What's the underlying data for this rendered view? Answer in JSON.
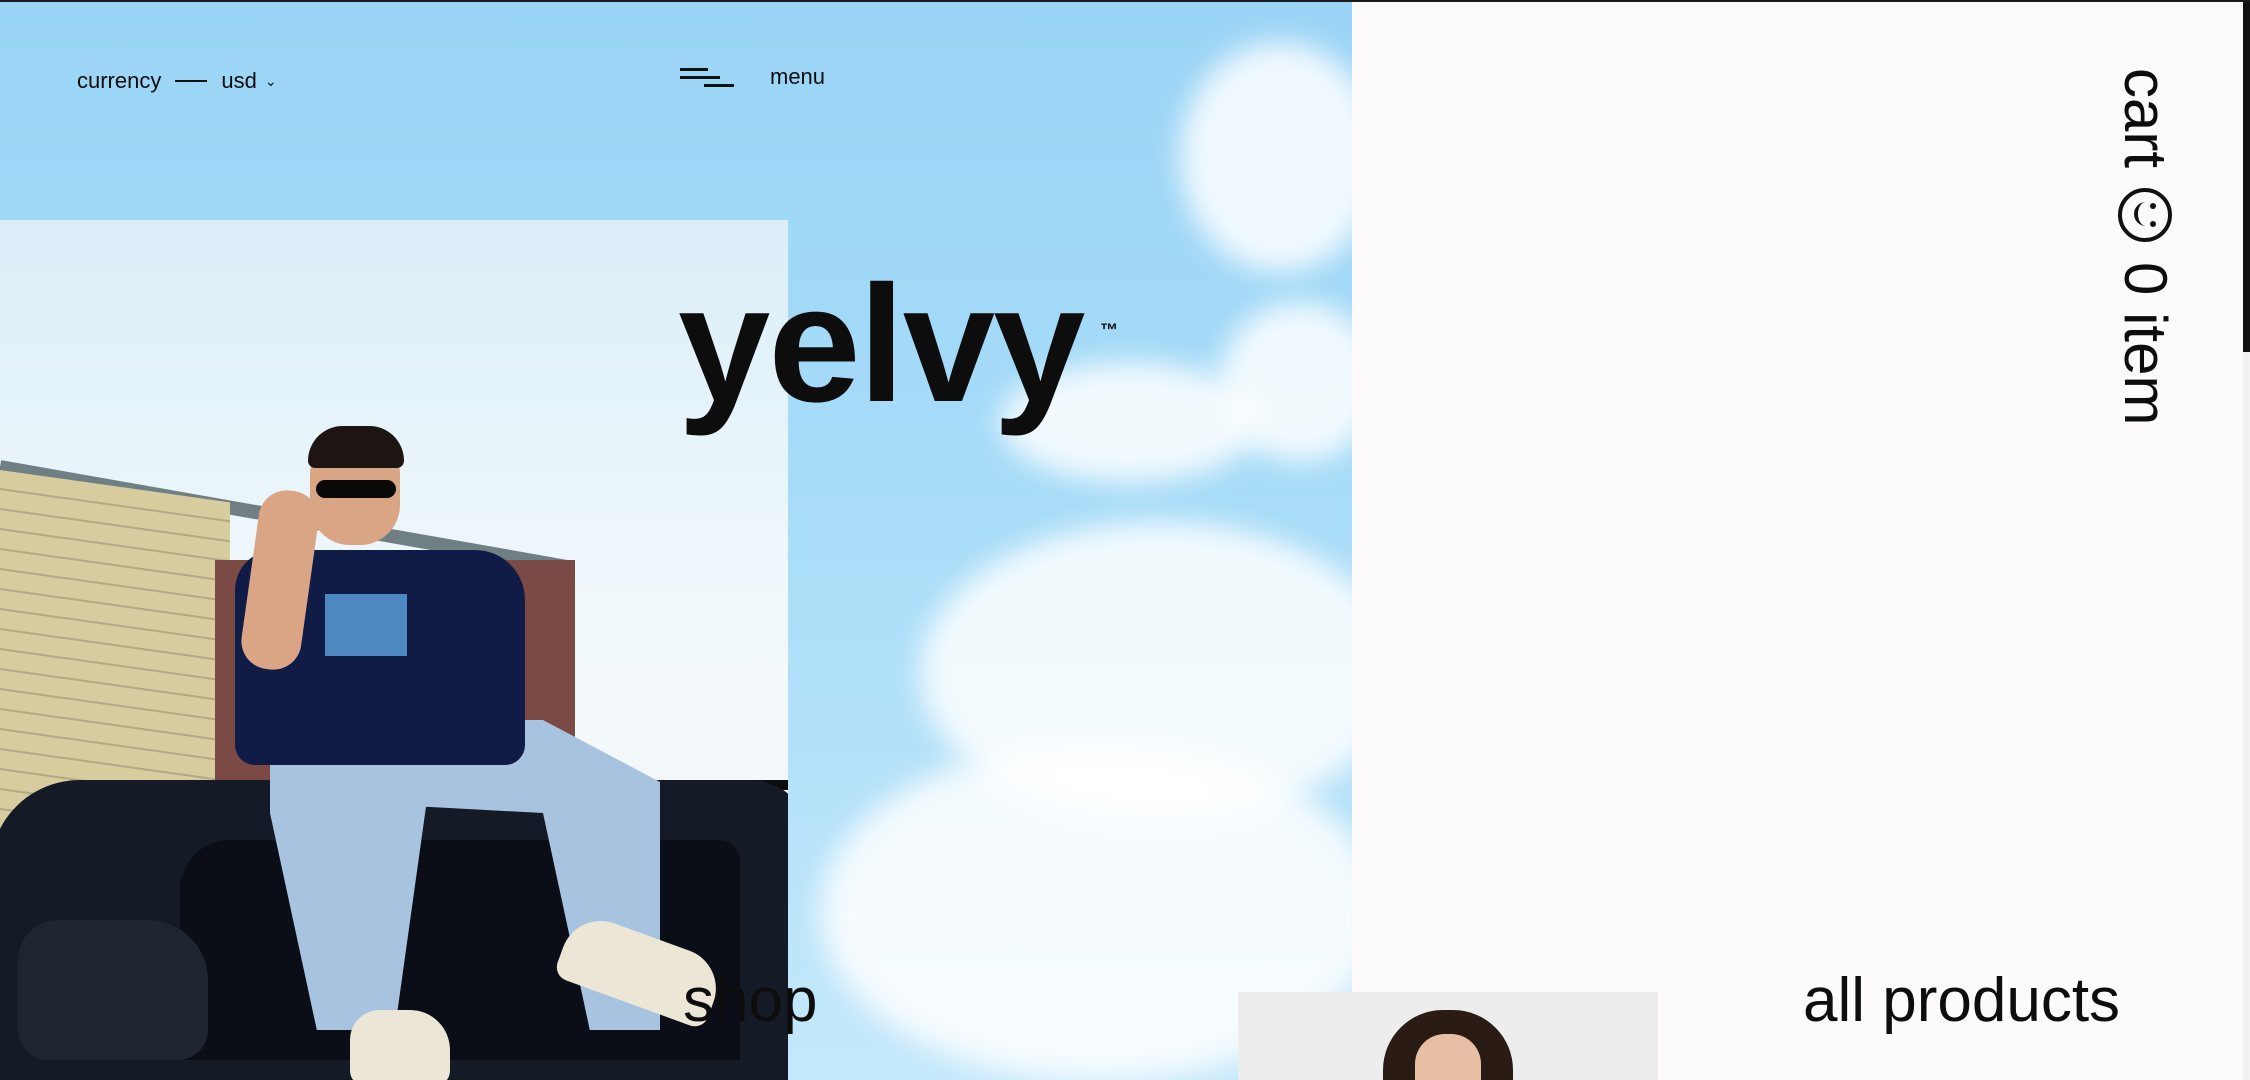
{
  "header": {
    "currency_label": "currency",
    "currency_value": "usd",
    "menu_label": "menu"
  },
  "brand": {
    "name": "yelvy",
    "trademark": "™"
  },
  "cart": {
    "label": "cart",
    "count_label": "0 item"
  },
  "sections": {
    "shop_label": "shop",
    "all_products_label": "all products"
  },
  "icons": {
    "menu": "menu-lines-icon",
    "cart": "smiley-icon",
    "currency_dropdown": "chevron-down-icon"
  },
  "colors": {
    "sky": "#9ad4f6",
    "panel": "#fcfafa",
    "text": "#0d0d0d"
  }
}
